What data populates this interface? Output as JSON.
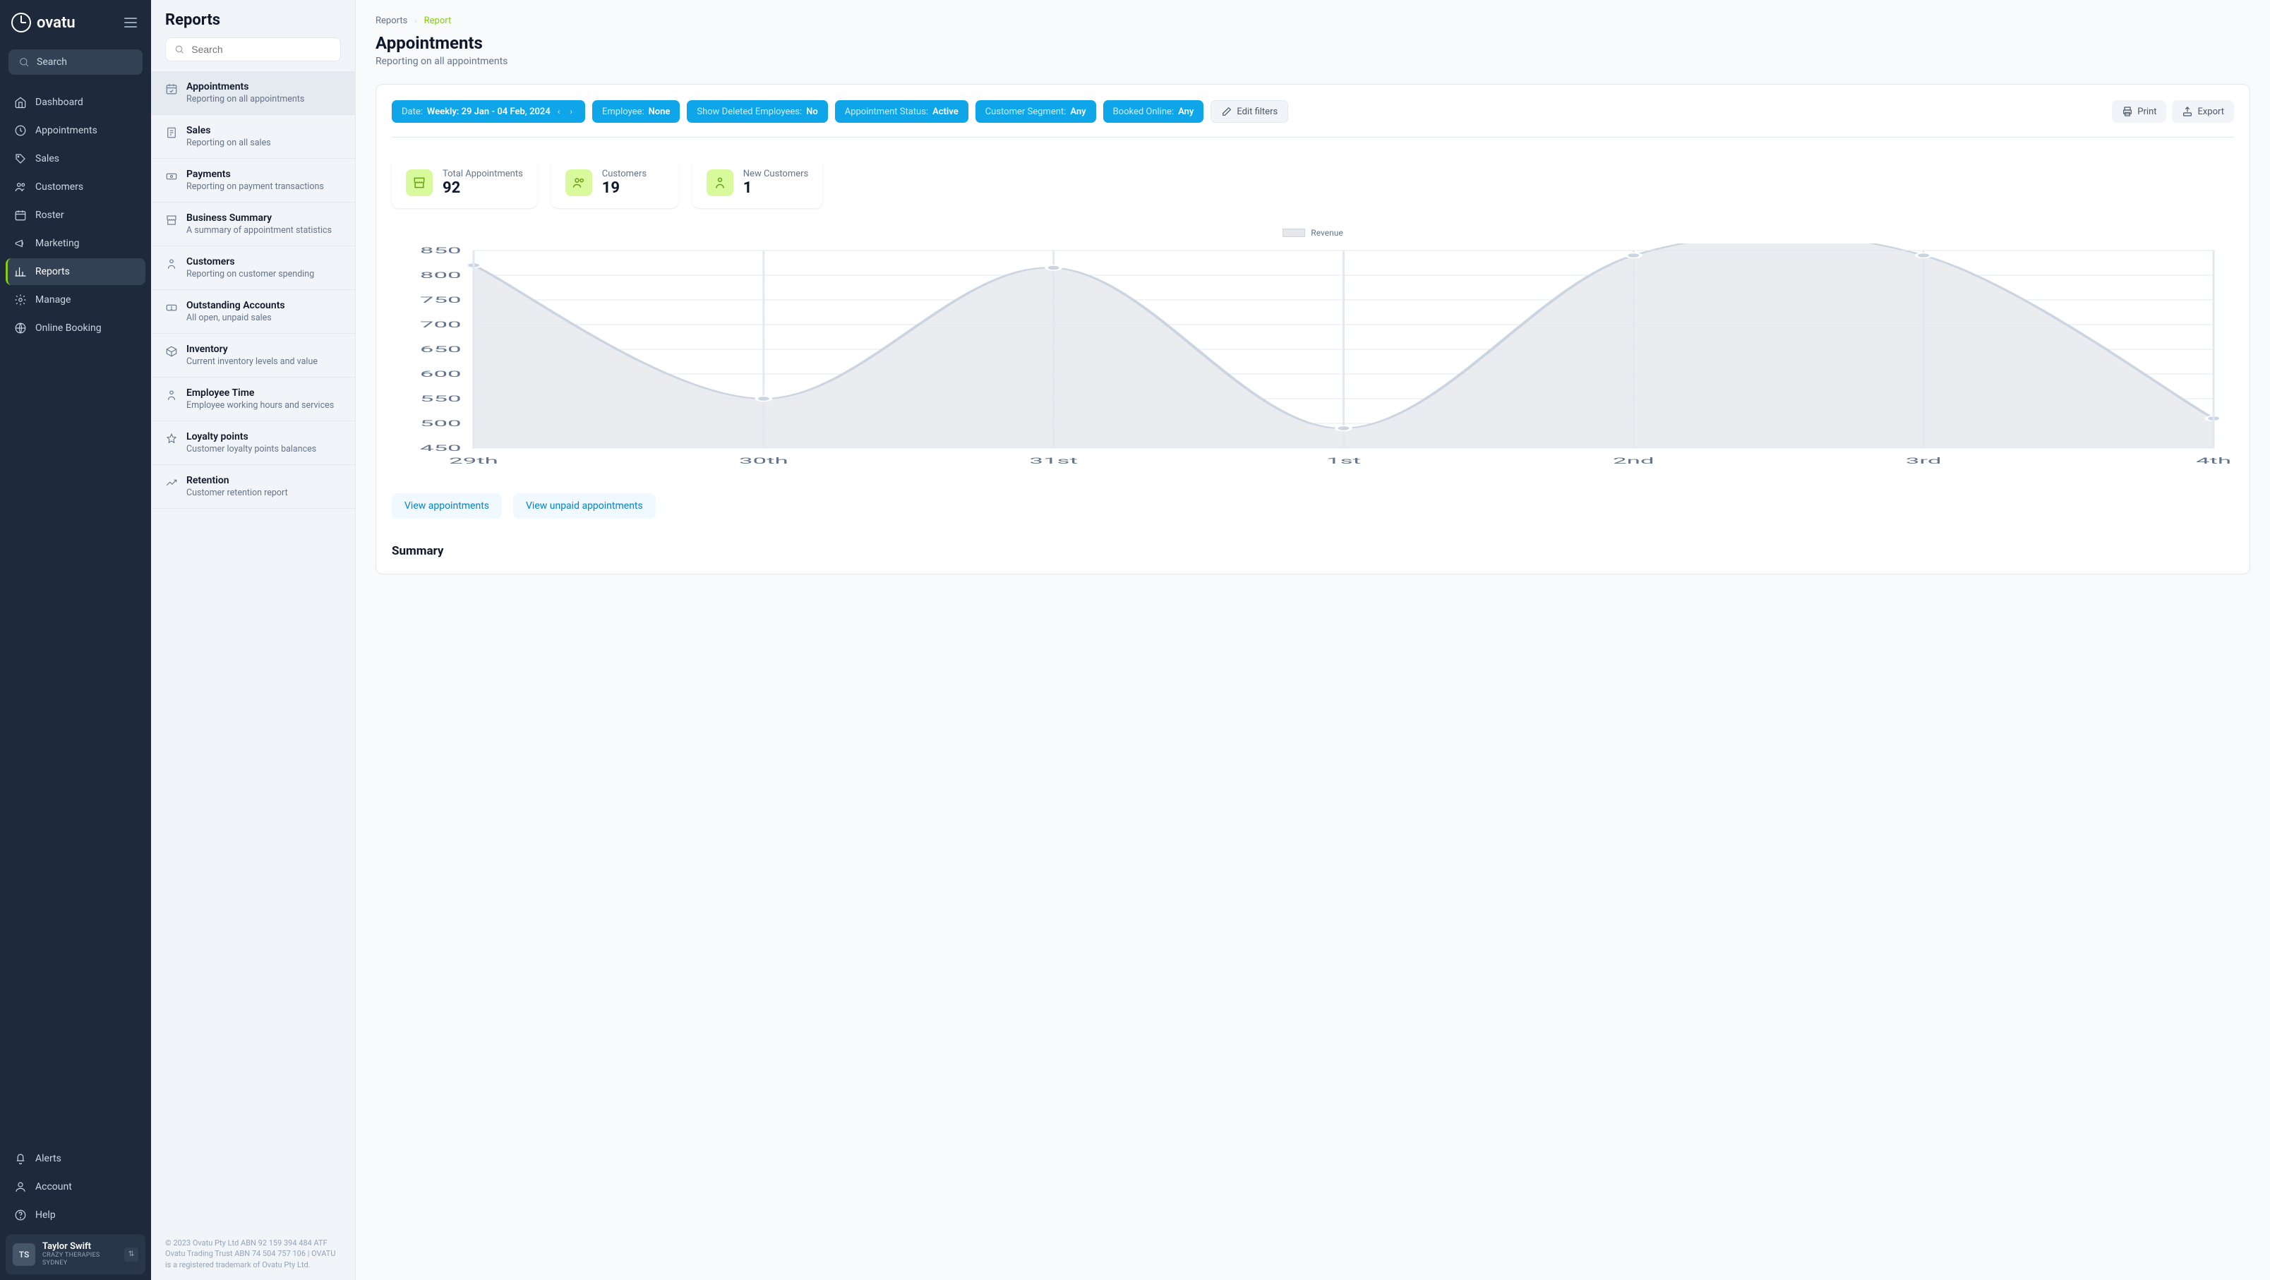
{
  "brand": "ovatu",
  "sidebar": {
    "search_label": "Search",
    "nav": [
      {
        "key": "dashboard",
        "label": "Dashboard"
      },
      {
        "key": "appointments",
        "label": "Appointments"
      },
      {
        "key": "sales",
        "label": "Sales"
      },
      {
        "key": "customers",
        "label": "Customers"
      },
      {
        "key": "roster",
        "label": "Roster"
      },
      {
        "key": "marketing",
        "label": "Marketing"
      },
      {
        "key": "reports",
        "label": "Reports"
      },
      {
        "key": "manage",
        "label": "Manage"
      },
      {
        "key": "online-booking",
        "label": "Online Booking"
      }
    ],
    "footer_nav": [
      {
        "key": "alerts",
        "label": "Alerts"
      },
      {
        "key": "account",
        "label": "Account"
      },
      {
        "key": "help",
        "label": "Help"
      }
    ],
    "user": {
      "initials": "TS",
      "name": "Taylor Swift",
      "sub": "CRAZY THERAPIES SYDNEY"
    }
  },
  "reports_panel": {
    "title": "Reports",
    "search_placeholder": "Search",
    "items": [
      {
        "key": "appointments",
        "title": "Appointments",
        "desc": "Reporting on all appointments"
      },
      {
        "key": "sales",
        "title": "Sales",
        "desc": "Reporting on all sales"
      },
      {
        "key": "payments",
        "title": "Payments",
        "desc": "Reporting on payment transactions"
      },
      {
        "key": "business-summary",
        "title": "Business Summary",
        "desc": "A summary of appointment statistics"
      },
      {
        "key": "customers",
        "title": "Customers",
        "desc": "Reporting on customer spending"
      },
      {
        "key": "outstanding-accounts",
        "title": "Outstanding Accounts",
        "desc": "All open, unpaid sales"
      },
      {
        "key": "inventory",
        "title": "Inventory",
        "desc": "Current inventory levels and value"
      },
      {
        "key": "employee-time",
        "title": "Employee Time",
        "desc": "Employee working hours and services"
      },
      {
        "key": "loyalty-points",
        "title": "Loyalty points",
        "desc": "Customer loyalty points balances"
      },
      {
        "key": "retention",
        "title": "Retention",
        "desc": "Customer retention report"
      }
    ],
    "copyright": "© 2023 Ovatu Pty Ltd ABN 92 159 394 484 ATF Ovatu Trading Trust ABN 74 504 757 106 | OVATU is a registered trademark of Ovatu Pty Ltd."
  },
  "breadcrumb": {
    "parent": "Reports",
    "current": "Report"
  },
  "page": {
    "title": "Appointments",
    "subtitle": "Reporting on all appointments"
  },
  "filters": {
    "date": {
      "label": "Date:",
      "value": "Weekly: 29 Jan - 04 Feb, 2024"
    },
    "employee": {
      "label": "Employee:",
      "value": "None"
    },
    "show_deleted": {
      "label": "Show Deleted Employees:",
      "value": "No"
    },
    "appointment_status": {
      "label": "Appointment Status:",
      "value": "Active"
    },
    "customer_segment": {
      "label": "Customer Segment:",
      "value": "Any"
    },
    "booked_online": {
      "label": "Booked Online:",
      "value": "Any"
    },
    "edit_label": "Edit filters"
  },
  "actions": {
    "print": "Print",
    "export": "Export"
  },
  "stats": {
    "total_appointments": {
      "label": "Total Appointments",
      "value": "92"
    },
    "customers": {
      "label": "Customers",
      "value": "19"
    },
    "new_customers": {
      "label": "New Customers",
      "value": "1"
    }
  },
  "chart_legend": "Revenue",
  "chart_data": {
    "type": "area",
    "series": [
      {
        "name": "Revenue",
        "values": [
          820,
          550,
          815,
          490,
          840,
          840,
          510
        ]
      }
    ],
    "categories": [
      "29th",
      "30th",
      "31st",
      "1st",
      "2nd",
      "3rd",
      "4th"
    ],
    "ylim": [
      450,
      850
    ],
    "ytick": [
      450,
      500,
      550,
      600,
      650,
      700,
      750,
      800,
      850
    ],
    "title": "",
    "xlabel": "",
    "ylabel": ""
  },
  "quick_links": {
    "view_appointments": "View appointments",
    "view_unpaid": "View unpaid appointments"
  },
  "summary_heading": "Summary"
}
